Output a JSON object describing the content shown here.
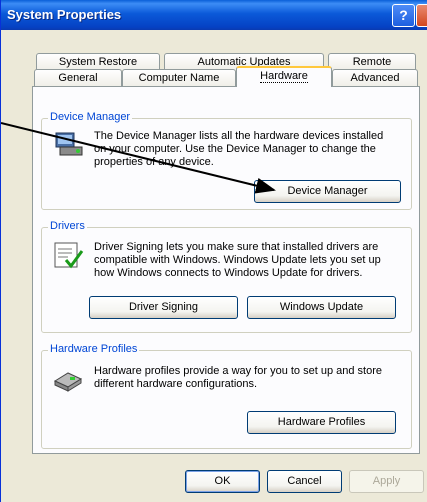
{
  "window": {
    "title": "System Properties",
    "help_glyph": "?"
  },
  "tabs": {
    "row1": [
      "System Restore",
      "Automatic Updates",
      "Remote"
    ],
    "row2": [
      "General",
      "Computer Name",
      "Hardware",
      "Advanced"
    ]
  },
  "device_manager": {
    "label": "Device Manager",
    "line1": "The Device Manager lists all the hardware devices installed",
    "line2": "on your computer. Use the Device Manager to change the",
    "line3": "properties of any device.",
    "button": "Device Manager"
  },
  "drivers": {
    "label": "Drivers",
    "line1": "Driver Signing lets you make sure that installed drivers are",
    "line2": "compatible with Windows. Windows Update lets you set up",
    "line3": "how Windows connects to Windows Update for drivers.",
    "signing_button": "Driver Signing",
    "update_button": "Windows Update"
  },
  "hardware_profiles": {
    "label": "Hardware Profiles",
    "line1": "Hardware profiles provide a way for you to set up and store",
    "line2": "different hardware configurations.",
    "button": "Hardware Profiles"
  },
  "footer": {
    "ok": "OK",
    "cancel": "Cancel",
    "apply": "Apply"
  },
  "colors": {
    "title_bar": "#0a5fd8",
    "group_label": "#0046d5",
    "active_tab_accent": "#ffc83c"
  },
  "icons": [
    "help-icon",
    "close-icon",
    "device-manager-icon",
    "driver-signing-icon",
    "hardware-profile-icon",
    "annotation-arrow"
  ]
}
